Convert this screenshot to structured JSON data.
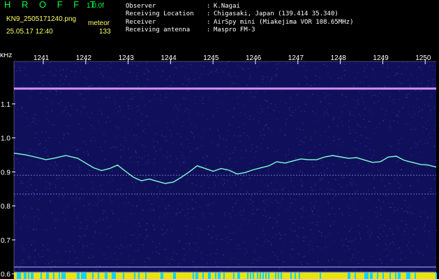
{
  "header": {
    "app_title": "H R O F F T",
    "version": "1.0.0f",
    "filename": "KN9_2505171240.png",
    "mode_label": "meteor",
    "timestamp": "25.05.17 12:40",
    "count": "133",
    "info": [
      {
        "label": "Observer",
        "value": "K.Nagai"
      },
      {
        "label": "Receiving Location",
        "value": "Chigasaki, Japan (139.414 35.340)"
      },
      {
        "label": "Receiver",
        "value": "AirSpy mini (Miakejima VOR 108.65MHz)"
      },
      {
        "label": "Receiving antenna",
        "value": "Maspro FM-3"
      }
    ]
  },
  "colors": {
    "background": "#10105a",
    "title": "#00ff44",
    "header_text": "#ffffff",
    "meta_text": "#ffff66",
    "trace": "#7fffd0",
    "axis": "#ffffff"
  },
  "chart_data": {
    "type": "line",
    "title": "",
    "xlabel": "",
    "ylabel": "kHz",
    "x_ticks": [
      "1241",
      "1242",
      "1243",
      "1244",
      "1245",
      "1246",
      "1247",
      "1248",
      "1249",
      "1250"
    ],
    "y_ticks": [
      "1.1",
      "1.0",
      "0.9",
      "0.8",
      "0.7",
      "0.6"
    ],
    "ylim": [
      0.585,
      1.225
    ],
    "x_range": [
      "12:40",
      "12:50"
    ],
    "carrier_khz": 1.145,
    "steady_lines_khz": [
      0.835,
      0.89,
      0.62,
      0.605
    ],
    "series": [
      {
        "points": [
          [
            0,
            0.955
          ],
          [
            0.3,
            0.95
          ],
          [
            0.6,
            0.942
          ],
          [
            0.8,
            0.936
          ],
          [
            1.0,
            0.94
          ],
          [
            1.3,
            0.948
          ],
          [
            1.6,
            0.94
          ],
          [
            1.8,
            0.926
          ],
          [
            2.0,
            0.912
          ],
          [
            2.2,
            0.904
          ],
          [
            2.4,
            0.91
          ],
          [
            2.6,
            0.92
          ],
          [
            2.8,
            0.902
          ],
          [
            3.0,
            0.884
          ],
          [
            3.2,
            0.874
          ],
          [
            3.4,
            0.879
          ],
          [
            3.6,
            0.872
          ],
          [
            3.8,
            0.866
          ],
          [
            4.0,
            0.87
          ],
          [
            4.2,
            0.884
          ],
          [
            4.4,
            0.9
          ],
          [
            4.6,
            0.918
          ],
          [
            4.8,
            0.91
          ],
          [
            5.0,
            0.902
          ],
          [
            5.2,
            0.91
          ],
          [
            5.4,
            0.905
          ],
          [
            5.6,
            0.894
          ],
          [
            5.8,
            0.898
          ],
          [
            6.0,
            0.906
          ],
          [
            6.2,
            0.912
          ],
          [
            6.4,
            0.918
          ],
          [
            6.6,
            0.93
          ],
          [
            6.8,
            0.926
          ],
          [
            7.0,
            0.932
          ],
          [
            7.2,
            0.938
          ],
          [
            7.4,
            0.936
          ],
          [
            7.6,
            0.936
          ],
          [
            7.8,
            0.944
          ],
          [
            8.0,
            0.948
          ],
          [
            8.2,
            0.944
          ],
          [
            8.4,
            0.94
          ],
          [
            8.6,
            0.942
          ],
          [
            8.8,
            0.935
          ],
          [
            9.0,
            0.928
          ],
          [
            9.2,
            0.93
          ],
          [
            9.4,
            0.944
          ],
          [
            9.6,
            0.946
          ],
          [
            9.8,
            0.934
          ],
          [
            10.0,
            0.928
          ],
          [
            10.2,
            0.922
          ],
          [
            10.4,
            0.92
          ],
          [
            10.6,
            0.914
          ]
        ]
      }
    ]
  }
}
